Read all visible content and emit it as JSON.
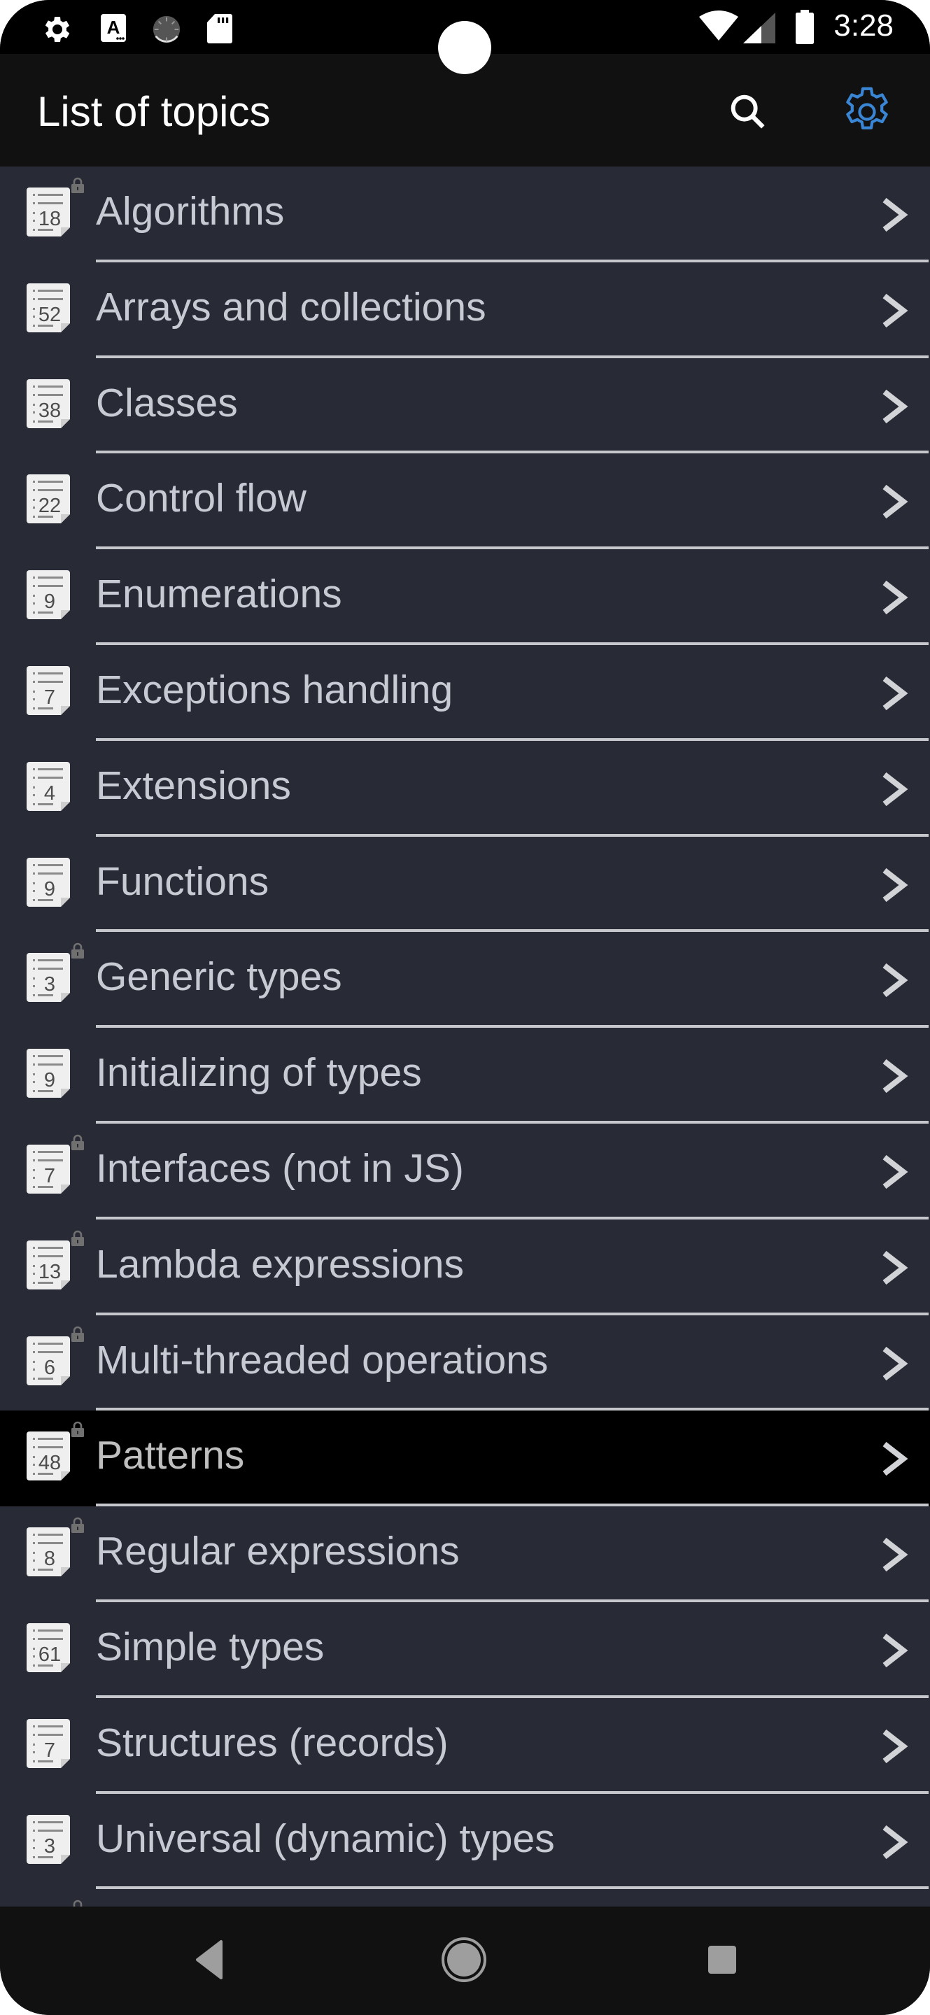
{
  "status_bar": {
    "time": "3:28",
    "left_icons": [
      "settings-icon",
      "accessibility-a-icon",
      "sync-progress-icon",
      "sd-card-icon"
    ],
    "right_icons": [
      "wifi-icon",
      "cell-signal-icon",
      "battery-icon"
    ]
  },
  "toolbar": {
    "title": "List of topics",
    "search_icon": "search-icon",
    "settings_icon": "gear-icon",
    "accent_color": "#3a86d4"
  },
  "topics": [
    {
      "label": "Algorithms",
      "count": "18",
      "locked": true,
      "selected": false
    },
    {
      "label": "Arrays and collections",
      "count": "52",
      "locked": false,
      "selected": false
    },
    {
      "label": "Classes",
      "count": "38",
      "locked": false,
      "selected": false
    },
    {
      "label": "Control flow",
      "count": "22",
      "locked": false,
      "selected": false
    },
    {
      "label": "Enumerations",
      "count": "9",
      "locked": false,
      "selected": false
    },
    {
      "label": "Exceptions handling",
      "count": "7",
      "locked": false,
      "selected": false
    },
    {
      "label": "Extensions",
      "count": "4",
      "locked": false,
      "selected": false
    },
    {
      "label": "Functions",
      "count": "9",
      "locked": false,
      "selected": false
    },
    {
      "label": "Generic types",
      "count": "3",
      "locked": true,
      "selected": false
    },
    {
      "label": "Initializing of types",
      "count": "9",
      "locked": false,
      "selected": false
    },
    {
      "label": "Interfaces (not in JS)",
      "count": "7",
      "locked": true,
      "selected": false
    },
    {
      "label": "Lambda expressions",
      "count": "13",
      "locked": true,
      "selected": false
    },
    {
      "label": "Multi-threaded operations",
      "count": "6",
      "locked": true,
      "selected": false
    },
    {
      "label": "Patterns",
      "count": "48",
      "locked": true,
      "selected": true
    },
    {
      "label": "Regular expressions",
      "count": "8",
      "locked": true,
      "selected": false
    },
    {
      "label": "Simple types",
      "count": "61",
      "locked": false,
      "selected": false
    },
    {
      "label": "Structures (records)",
      "count": "7",
      "locked": false,
      "selected": false
    },
    {
      "label": "Universal (dynamic) types",
      "count": "3",
      "locked": false,
      "selected": false
    },
    {
      "label": "",
      "count": "",
      "locked": true,
      "selected": false
    }
  ],
  "nav_bar": {
    "back_icon": "back-triangle-icon",
    "home_icon": "home-circle-icon",
    "recents_icon": "recents-square-icon"
  }
}
